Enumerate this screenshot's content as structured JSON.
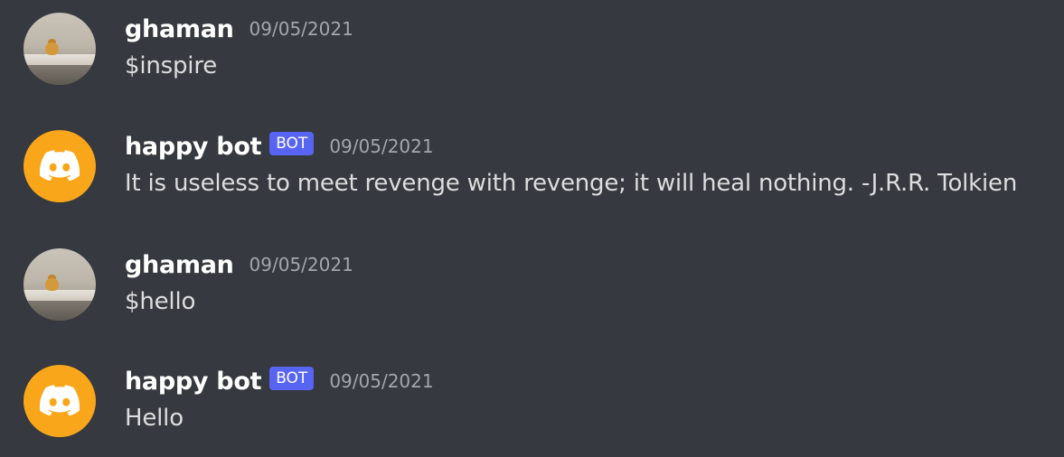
{
  "messages": [
    {
      "author": "ghaman",
      "is_bot": false,
      "bot_tag": "",
      "timestamp": "09/05/2021",
      "text": "$inspire",
      "avatar": "photo-avatar"
    },
    {
      "author": "happy bot",
      "is_bot": true,
      "bot_tag": "BOT",
      "timestamp": "09/05/2021",
      "text": "It is useless to meet revenge with revenge; it will heal nothing. -J.R.R. Tolkien",
      "avatar": "discord-logo-icon"
    },
    {
      "author": "ghaman",
      "is_bot": false,
      "bot_tag": "",
      "timestamp": "09/05/2021",
      "text": "$hello",
      "avatar": "photo-avatar"
    },
    {
      "author": "happy bot",
      "is_bot": true,
      "bot_tag": "BOT",
      "timestamp": "09/05/2021",
      "text": "Hello",
      "avatar": "discord-logo-icon"
    }
  ],
  "colors": {
    "background": "#36393f",
    "bot_avatar": "#faa61a",
    "bot_tag": "#5865f2",
    "username": "#ffffff",
    "timestamp": "#a3a6aa",
    "message_text": "#dcddde"
  }
}
